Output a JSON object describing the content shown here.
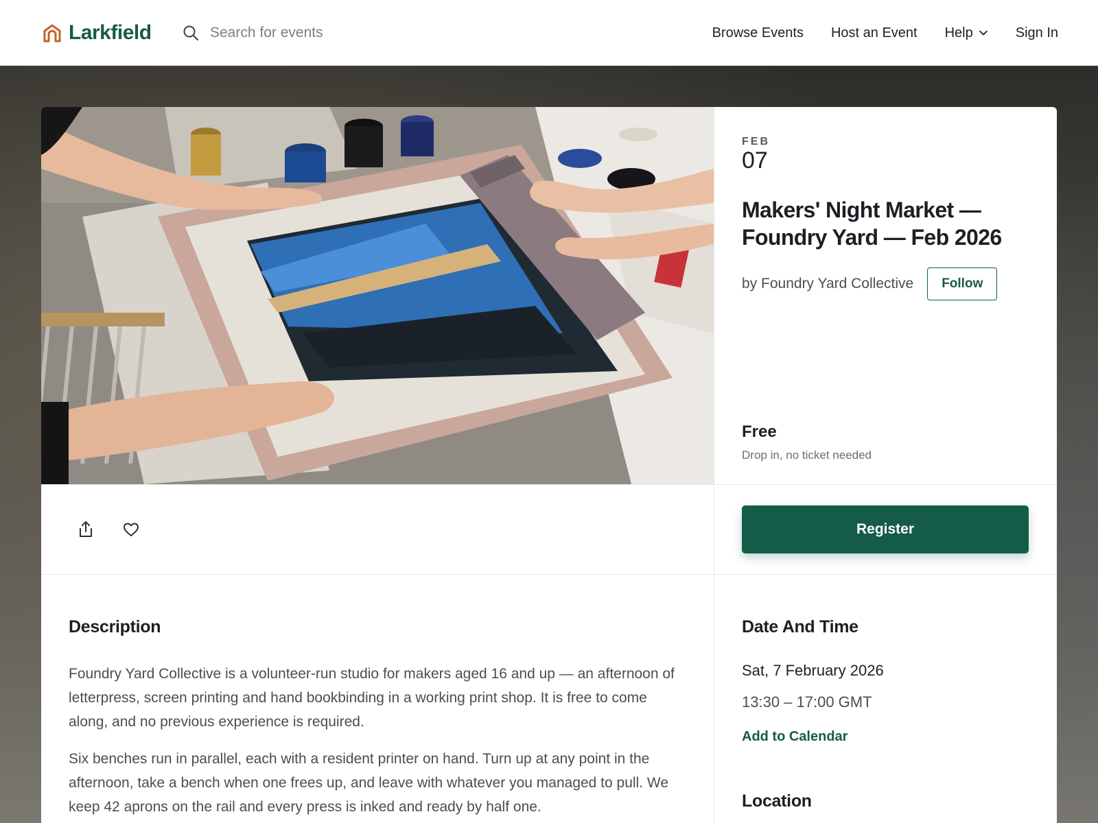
{
  "header": {
    "brand": "Larkfield",
    "search_placeholder": "Search for events",
    "nav": {
      "browse": "Browse Events",
      "host": "Host an Event",
      "help": "Help",
      "sign_in": "Sign In"
    }
  },
  "event": {
    "month": "FEB",
    "day": "07",
    "title": "Makers' Night Market — Foundry Yard — Feb 2026",
    "organizer": "by Foundry Yard Collective",
    "follow_label": "Follow",
    "price": "Free",
    "price_note": "Drop in, no ticket needed",
    "register_label": "Register"
  },
  "description": {
    "heading": "Description",
    "paragraphs": [
      "Foundry Yard Collective is a volunteer-run studio for makers aged 16 and up — an afternoon of letterpress, screen printing and hand bookbinding in a working print shop. It is free to come along, and no previous experience is required.",
      "Six benches run in parallel, each with a resident printer on hand. Turn up at any point in the afternoon, take a bench when one frees up, and leave with whatever you managed to pull. We keep 42 aprons on the rail and every press is inked and ready by half one."
    ]
  },
  "datetime": {
    "heading": "Date And Time",
    "date": "Sat, 7 February 2026",
    "time": "13:30 – 17:00 GMT",
    "add_to_calendar": "Add to Calendar"
  },
  "location": {
    "heading": "Location"
  },
  "icons": {
    "logo": "house-arch-icon",
    "search": "search-icon",
    "help_chevron": "chevron-down-icon",
    "share": "share-icon",
    "like": "heart-icon"
  },
  "colors": {
    "brand_green": "#145c47",
    "logo_orange": "#c2622b"
  }
}
